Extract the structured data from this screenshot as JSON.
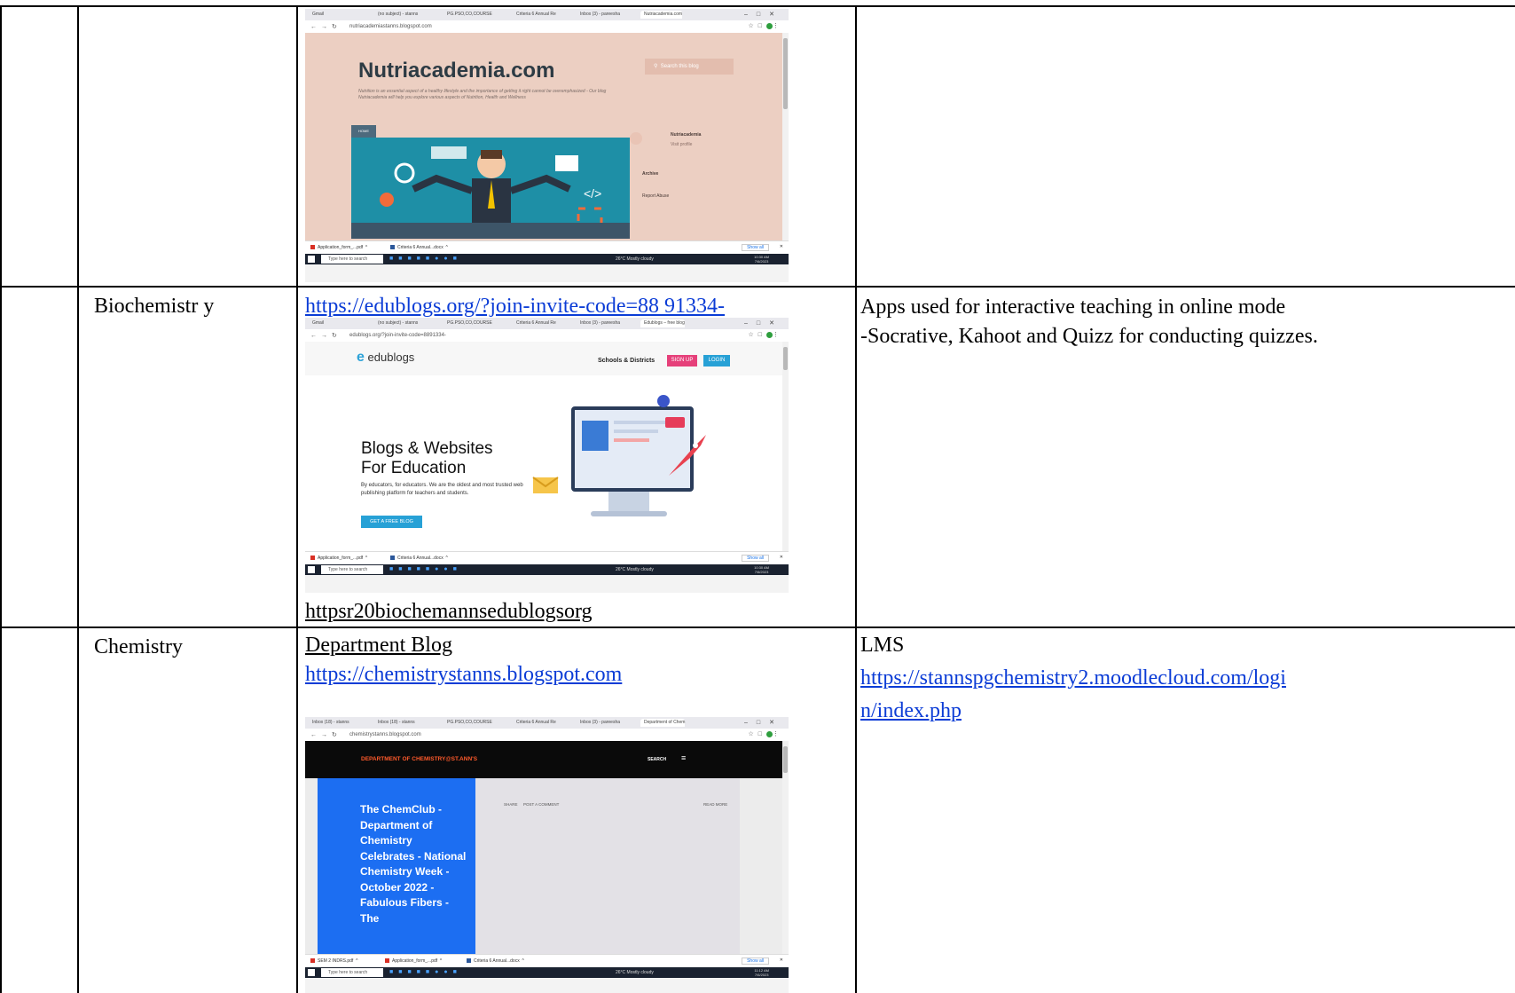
{
  "rows": [
    {
      "department": "",
      "tools_text": "",
      "other_text": "",
      "screenshot": {
        "tabs": [
          "Gmail",
          "(no subject) - stanns",
          "PG.PSO,CO,COURSE",
          "Criteria 6 Annual Re",
          "Inbox (3) - pareesha",
          "Nutriacademia.com"
        ],
        "url": "nutriacademiastanns.blogspot.com",
        "site_title": "Nutriacademia.com",
        "search_placeholder": "Search this blog",
        "description": "Nutrition is an essential aspect of a healthy lifestyle and the importance of getting it right cannot be overemphasized - Our blog Nutriacademia will help you explore various aspects of Nutrition, Health and Wellness",
        "home_label": "HOME",
        "profile_name": "Nutriacademia",
        "profile_link": "Visit profile",
        "archive_label": "Archive",
        "report_label": "Report Abuse",
        "downloads": [
          "Application_form_...pdf",
          "Criteria 6 Annual...docx"
        ],
        "show_all": "Show all",
        "taskbar_search": "Type here to search",
        "weather": "26°C  Mostly cloudy",
        "time": "10:30 AM",
        "date": "7/6/2023"
      }
    },
    {
      "department": "Biochemistr y",
      "link_text": "https://edublogs.org/?join-invite-code=88 91334-",
      "caption": "httpsr20biochemannsedublogsorg",
      "other_text_1": "Apps used for interactive teaching in online mode",
      "other_text_2": "-Socrative, Kahoot and Quizz for conducting quizzes.",
      "screenshot": {
        "tabs": [
          "Gmail",
          "(no subject) - stanns",
          "PG.PSO,CO,COURSE",
          "Criteria 6 Annual Re",
          "Inbox (3) - pareesha",
          "Edublogs – free blog"
        ],
        "url": "edublogs.org/?join-invite-code=8891334-",
        "logo": "edublogs",
        "nav_link": "Schools & Districts",
        "signup": "SIGN UP",
        "login": "LOGIN",
        "heading_1": "Blogs & Websites",
        "heading_2": "For Education",
        "paragraph": "By educators, for educators. We are the oldest and most trusted web publishing platform for teachers and students.",
        "button": "GET A FREE BLOG",
        "downloads": [
          "Application_form_...pdf",
          "Criteria 6 Annual...docx"
        ],
        "show_all": "Show all",
        "taskbar_search": "Type here to search",
        "weather": "26°C  Mostly cloudy",
        "time": "10:30 AM",
        "date": "7/6/2023"
      }
    },
    {
      "department": "Chemistry",
      "tools_label": "Department Blog",
      "link_text": "https://chemistrystanns.blogspot.com",
      "other_label": "LMS",
      "other_link_1": "https://stannspgchemistry2.moodlecloud.com/logi",
      "other_link_2": "n/index.php",
      "screenshot": {
        "tabs": [
          "Inbox (18) - stanns",
          "Inbox (18) - stanns",
          "PG.PSO,CO,COURSE",
          "Criteria 6 Annual Re",
          "Inbox (3) - pareesha",
          "Department of Chem"
        ],
        "url": "chemistrystanns.blogspot.com",
        "header": "DEPARTMENT OF CHEMISTRY@ST.ANN'S",
        "search": "SEARCH",
        "post_title": "The ChemClub - Department of Chemistry Celebrates - National Chemistry Week - October 2022 - Fabulous Fibers - The",
        "share": "SHARE",
        "post_comment": "POST A COMMENT",
        "read_more": "READ MORE",
        "downloads": [
          "SEM 2 INDRS.pdf",
          "Application_form_...pdf",
          "Criteria 6 Annual...docx"
        ],
        "show_all": "Show all",
        "taskbar_search": "Type here to search",
        "weather": "26°C  Mostly cloudy",
        "time": "11:12 AM",
        "date": "7/6/2023"
      }
    }
  ],
  "colors": {
    "link": "#0b3cd6",
    "nutri_bg": "#eccfc2",
    "edublogs_blue": "#27a1d6",
    "chem_blue": "#1c6ef2",
    "chem_orange": "#ff5a2b"
  },
  "icons": [
    "windows-icon",
    "search-icon",
    "close-icon",
    "minimize-icon",
    "maximize-icon",
    "pdf-icon",
    "word-doc-icon",
    "menu-icon",
    "back-arrow-icon",
    "forward-arrow-icon",
    "reload-icon",
    "lock-icon"
  ]
}
